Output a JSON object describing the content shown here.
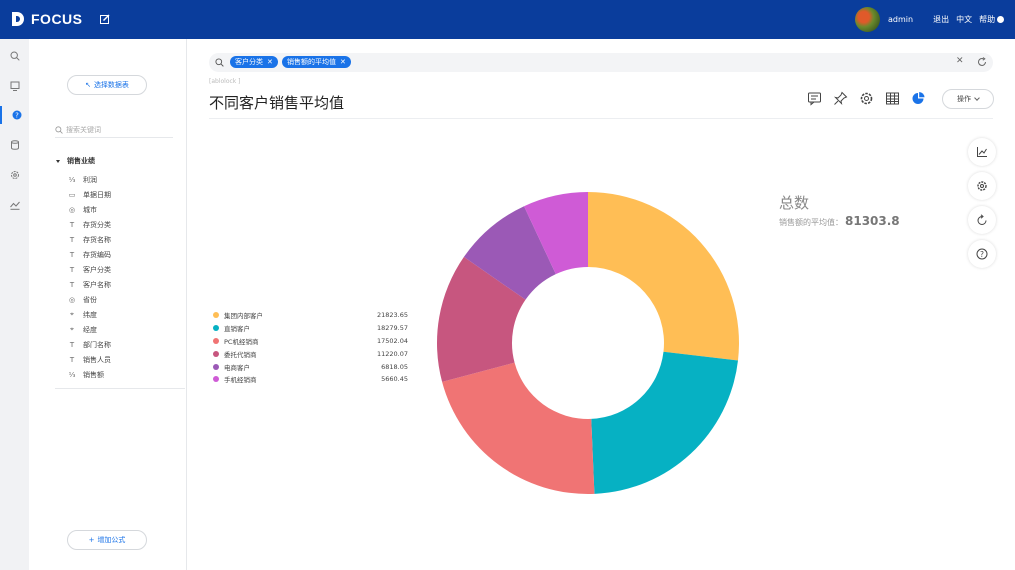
{
  "header": {
    "logo_text": "FOCUS",
    "user": "admin",
    "logout": "退出",
    "language": "中文",
    "help": "帮助"
  },
  "sidebar": {
    "select_table": "选择数据表",
    "search_placeholder": "搜索关键词",
    "root": "销售业绩",
    "fields": [
      {
        "label": "利润",
        "icon": "measure-icon"
      },
      {
        "label": "单据日期",
        "icon": "calendar-icon"
      },
      {
        "label": "城市",
        "icon": "globe-icon"
      },
      {
        "label": "存货分类",
        "icon": "text-attribute-icon"
      },
      {
        "label": "存货名称",
        "icon": "text-attribute-icon"
      },
      {
        "label": "存货编码",
        "icon": "text-attribute-icon"
      },
      {
        "label": "客户分类",
        "icon": "text-attribute-icon"
      },
      {
        "label": "客户名称",
        "icon": "text-attribute-icon"
      },
      {
        "label": "省份",
        "icon": "globe-icon"
      },
      {
        "label": "纬度",
        "icon": "coordinate-icon"
      },
      {
        "label": "经度",
        "icon": "coordinate-icon"
      },
      {
        "label": "部门名称",
        "icon": "text-attribute-icon"
      },
      {
        "label": "销售人员",
        "icon": "text-attribute-icon"
      },
      {
        "label": "销售额",
        "icon": "measure-icon"
      }
    ],
    "add_formula": "增加公式"
  },
  "search": {
    "tags": [
      "客户分类",
      "销售额的平均值"
    ]
  },
  "main": {
    "breadcrumb": "[ablolock ]",
    "title": "不同客户销售平均值",
    "operate": "操作"
  },
  "kpi": {
    "title": "总数",
    "label": "销售额的平均值：",
    "value": "81303.8"
  },
  "colors": {
    "brand": "#0a3d9c",
    "accent": "#1a73e8"
  },
  "chart_data": {
    "type": "pie",
    "subtype": "donut",
    "legend_position": "left",
    "categories": [
      "集团内部客户",
      "直销客户",
      "PC机经销商",
      "委托代销商",
      "电商客户",
      "手机经销商"
    ],
    "values": [
      21823.65,
      18279.57,
      17502.04,
      11220.07,
      6818.05,
      5660.45
    ],
    "value_labels": [
      "21823.65",
      "18279.57",
      "17502.04",
      "11220.07",
      "6818.05",
      "5660.45"
    ],
    "colors": [
      "#ffbe55",
      "#06b1c3",
      "#f07474",
      "#c7567f",
      "#9b59b6",
      "#cf5bd6"
    ]
  }
}
